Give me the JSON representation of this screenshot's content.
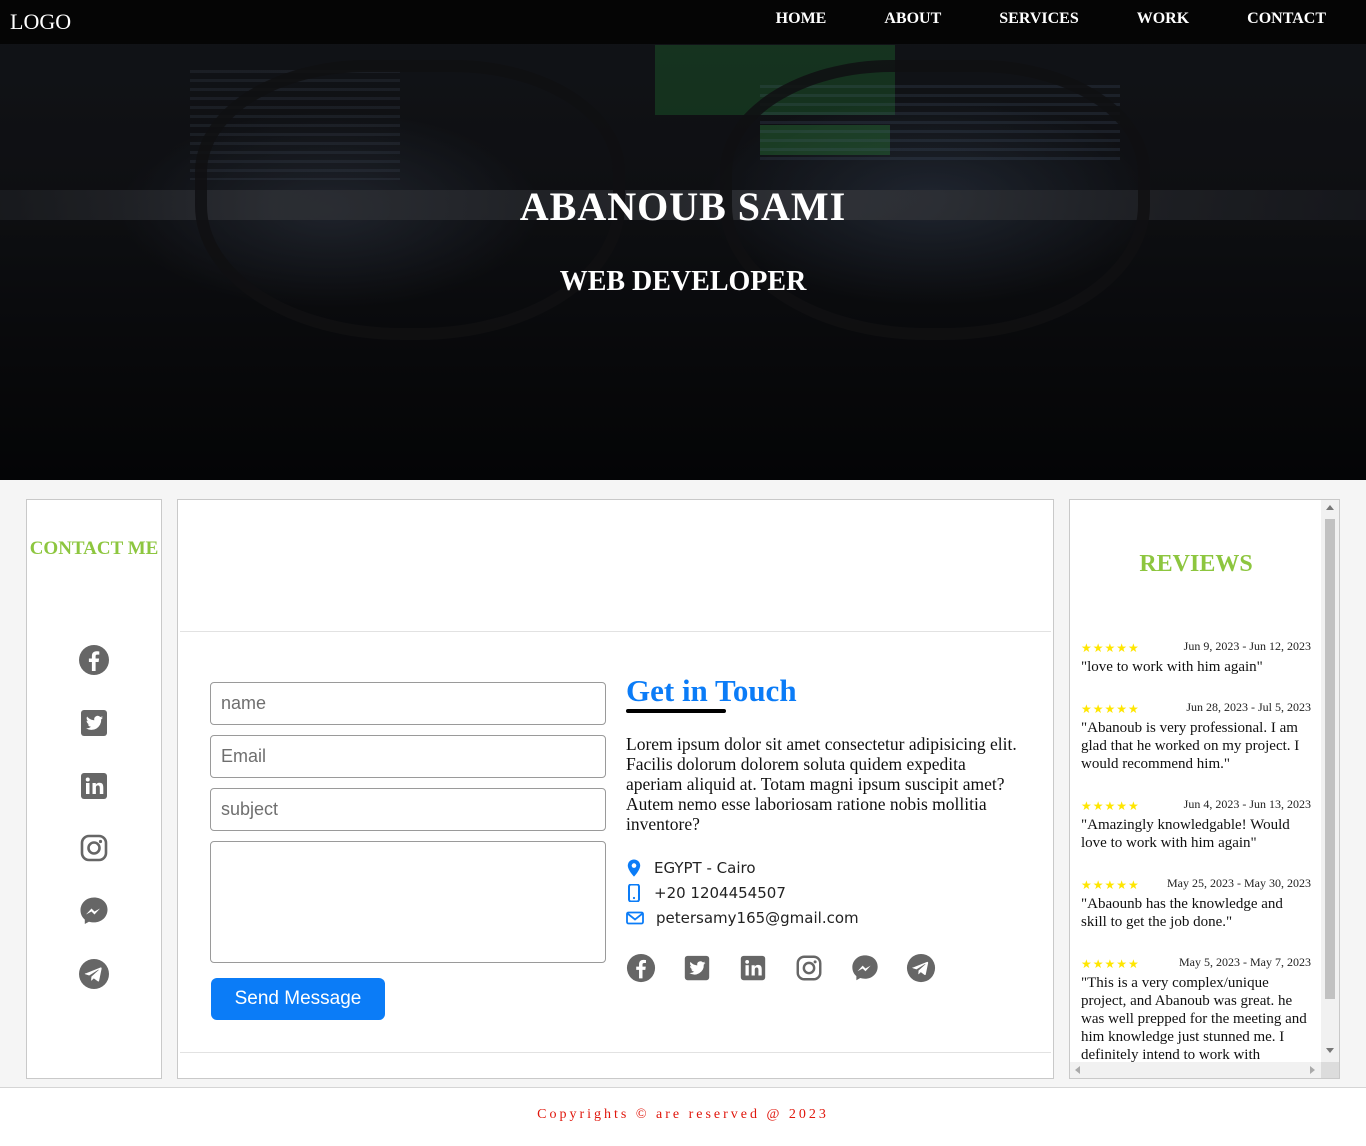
{
  "nav": {
    "logo": "LOGO",
    "items": [
      "HOME",
      "ABOUT",
      "SERVICES",
      "WORK",
      "CONTACT"
    ]
  },
  "hero": {
    "name": "ABANOUB SAMI",
    "role": "WEB DEVELOPER"
  },
  "contact_panel": {
    "title": "CONTACT ME",
    "icons": [
      "facebook-icon",
      "twitter-icon",
      "linkedin-icon",
      "instagram-icon",
      "messenger-icon",
      "telegram-icon"
    ]
  },
  "form": {
    "name_placeholder": "name",
    "email_placeholder": "Email",
    "subject_placeholder": "subject",
    "message_placeholder": "",
    "send_label": "Send Message"
  },
  "get_in_touch": {
    "title": "Get in Touch",
    "text": "Lorem ipsum dolor sit amet consectetur adipisicing elit. Facilis dolorum dolorem soluta quidem expedita aperiam aliquid at. Totam magni ipsum suscipit amet? Autem nemo esse laboriosam ratione nobis mollitia inventore?",
    "location": "EGYPT - Cairo",
    "phone": "+20 1204454507",
    "email": "petersamy165@gmail.com"
  },
  "reviews": {
    "title": "REVIEWS",
    "items": [
      {
        "stars": "★★★★★",
        "date": "Jun 9, 2023 - Jun 12, 2023",
        "text": "\"love to work with him again\""
      },
      {
        "stars": "★★★★★",
        "date": "Jun 28, 2023 - Jul 5, 2023",
        "text": "\"Abanoub is very professional. I am glad that he worked on my project. I would recommend him.\""
      },
      {
        "stars": "★★★★★",
        "date": "Jun 4, 2023 - Jun 13, 2023",
        "text": "\"Amazingly knowledgable! Would love to work with him again\""
      },
      {
        "stars": "★★★★★",
        "date": "May 25, 2023 - May 30, 2023",
        "text": "\"Abaounb has the knowledge and skill to get the job done.\""
      },
      {
        "stars": "★★★★★",
        "date": "May 5, 2023 - May 7, 2023",
        "text": "\"This is a very complex/unique project, and Abanoub was great. he was well prepped for the meeting and him knowledge just stunned me. I definitely intend to work with"
      }
    ]
  },
  "footer": {
    "copyright": "Copyrights © are reserved @ 2023"
  },
  "colors": {
    "accent_green": "#8dc63f",
    "accent_blue": "#0b7cf7",
    "footer_red": "#e0160b",
    "star_yellow": "#ffe600",
    "icon_gray": "#666666"
  }
}
